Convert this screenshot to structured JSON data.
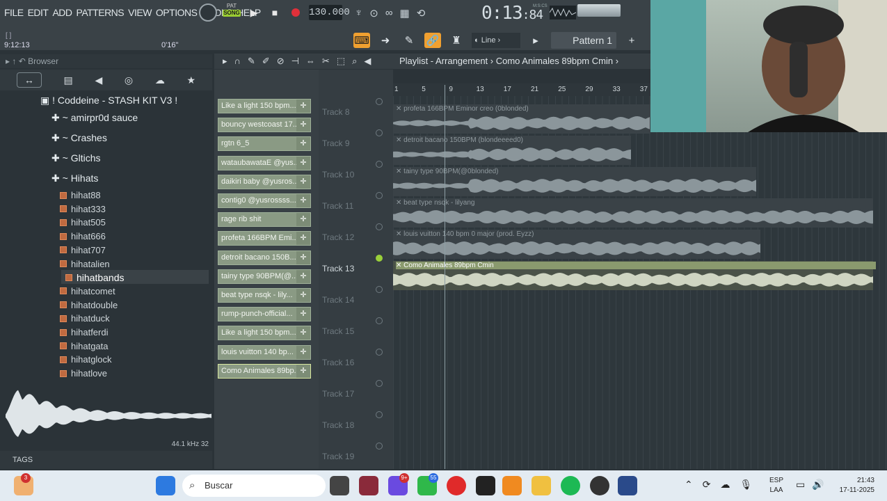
{
  "menu": [
    "FILE",
    "EDIT",
    "ADD",
    "PATTERNS",
    "VIEW",
    "OPTIONS",
    "TOOLS",
    "HELP"
  ],
  "hint_brackets": "[ ]",
  "song_time": "9:12:13",
  "song_length": "0'16\"",
  "transport": {
    "pat_label": "PAT",
    "song_label": "SONG",
    "tempo": "130.000"
  },
  "time_display": {
    "time": "0:13",
    "sub": ":84",
    "units": "M:S:CS"
  },
  "pattern_bar": {
    "snap": "Line",
    "pattern": "Pattern 1"
  },
  "browser": {
    "title": "Browser",
    "root": "! Coddeine - STASH KIT V3 !",
    "folders": [
      "~ amirpr0d sauce",
      "~ Crashes",
      "~ Gltichs",
      "~ Hihats"
    ],
    "files": [
      "hihat88",
      "hihat333",
      "hihat505",
      "hihat666",
      "hihat707",
      "hihatalien",
      "hihatbands",
      "hihatcomet",
      "hihatdouble",
      "hihatduck",
      "hihatferdi",
      "hihatgata",
      "hihatglock",
      "hihatlove"
    ],
    "selected_file": "hihatbands",
    "sample_info": "44.1 kHz 32",
    "tags_label": "TAGS"
  },
  "playlist": {
    "title": "Playlist - Arrangement",
    "arrangement": "Como Animales 89bpm Cmin",
    "ruler": [
      "1",
      "5",
      "9",
      "13",
      "17",
      "21",
      "25",
      "29",
      "33",
      "37"
    ],
    "clips": [
      "Like a light 150 bpm...",
      "bouncy westcoast 17...",
      "rgtn 6_5",
      "wataubawataE @yus...",
      "daikiri baby @yusros...",
      "contig0 @yusrossss...",
      "rage rib shit",
      "profeta 166BPM Emi...",
      "detroit bacano 150B...",
      "tainy type 90BPM(@...",
      "beat type nsqk - lily...",
      "rump-punch-official...",
      "Like a light 150 bpm...",
      "louis vuitton 140 bp...",
      "Como Animales 89bp..."
    ],
    "tracks": [
      "Track 8",
      "Track 9",
      "Track 10",
      "Track 11",
      "Track 12",
      "Track 13",
      "Track 14",
      "Track 15",
      "Track 16",
      "Track 17",
      "Track 18",
      "Track 19"
    ],
    "active_track": "Track 13",
    "lanes": [
      {
        "label": "profeta 166BPM Eminor creo (0blonded)",
        "color": "#5d676c"
      },
      {
        "label": "detroit bacano 150BPM (blondeeeed0)",
        "color": "#5d676c"
      },
      {
        "label": "tainy type 90BPM(@0blonded)",
        "color": "#5d676c"
      },
      {
        "label": "beat type nsqk - lilyang",
        "color": "#5d676c"
      },
      {
        "label": "louis vuitton 140 bpm 0 major (prod. Eyzz)",
        "color": "#5d676c"
      },
      {
        "label": "Como Animales 89bpm Cmin",
        "color": "#8a9a6e"
      }
    ]
  },
  "taskbar": {
    "search": "Buscar",
    "lang1": "ESP",
    "lang2": "LAA",
    "time": "21:43",
    "date": "17-11-2025",
    "badge_weather": "3",
    "badge_chat": "9+",
    "badge_wa": "55"
  }
}
